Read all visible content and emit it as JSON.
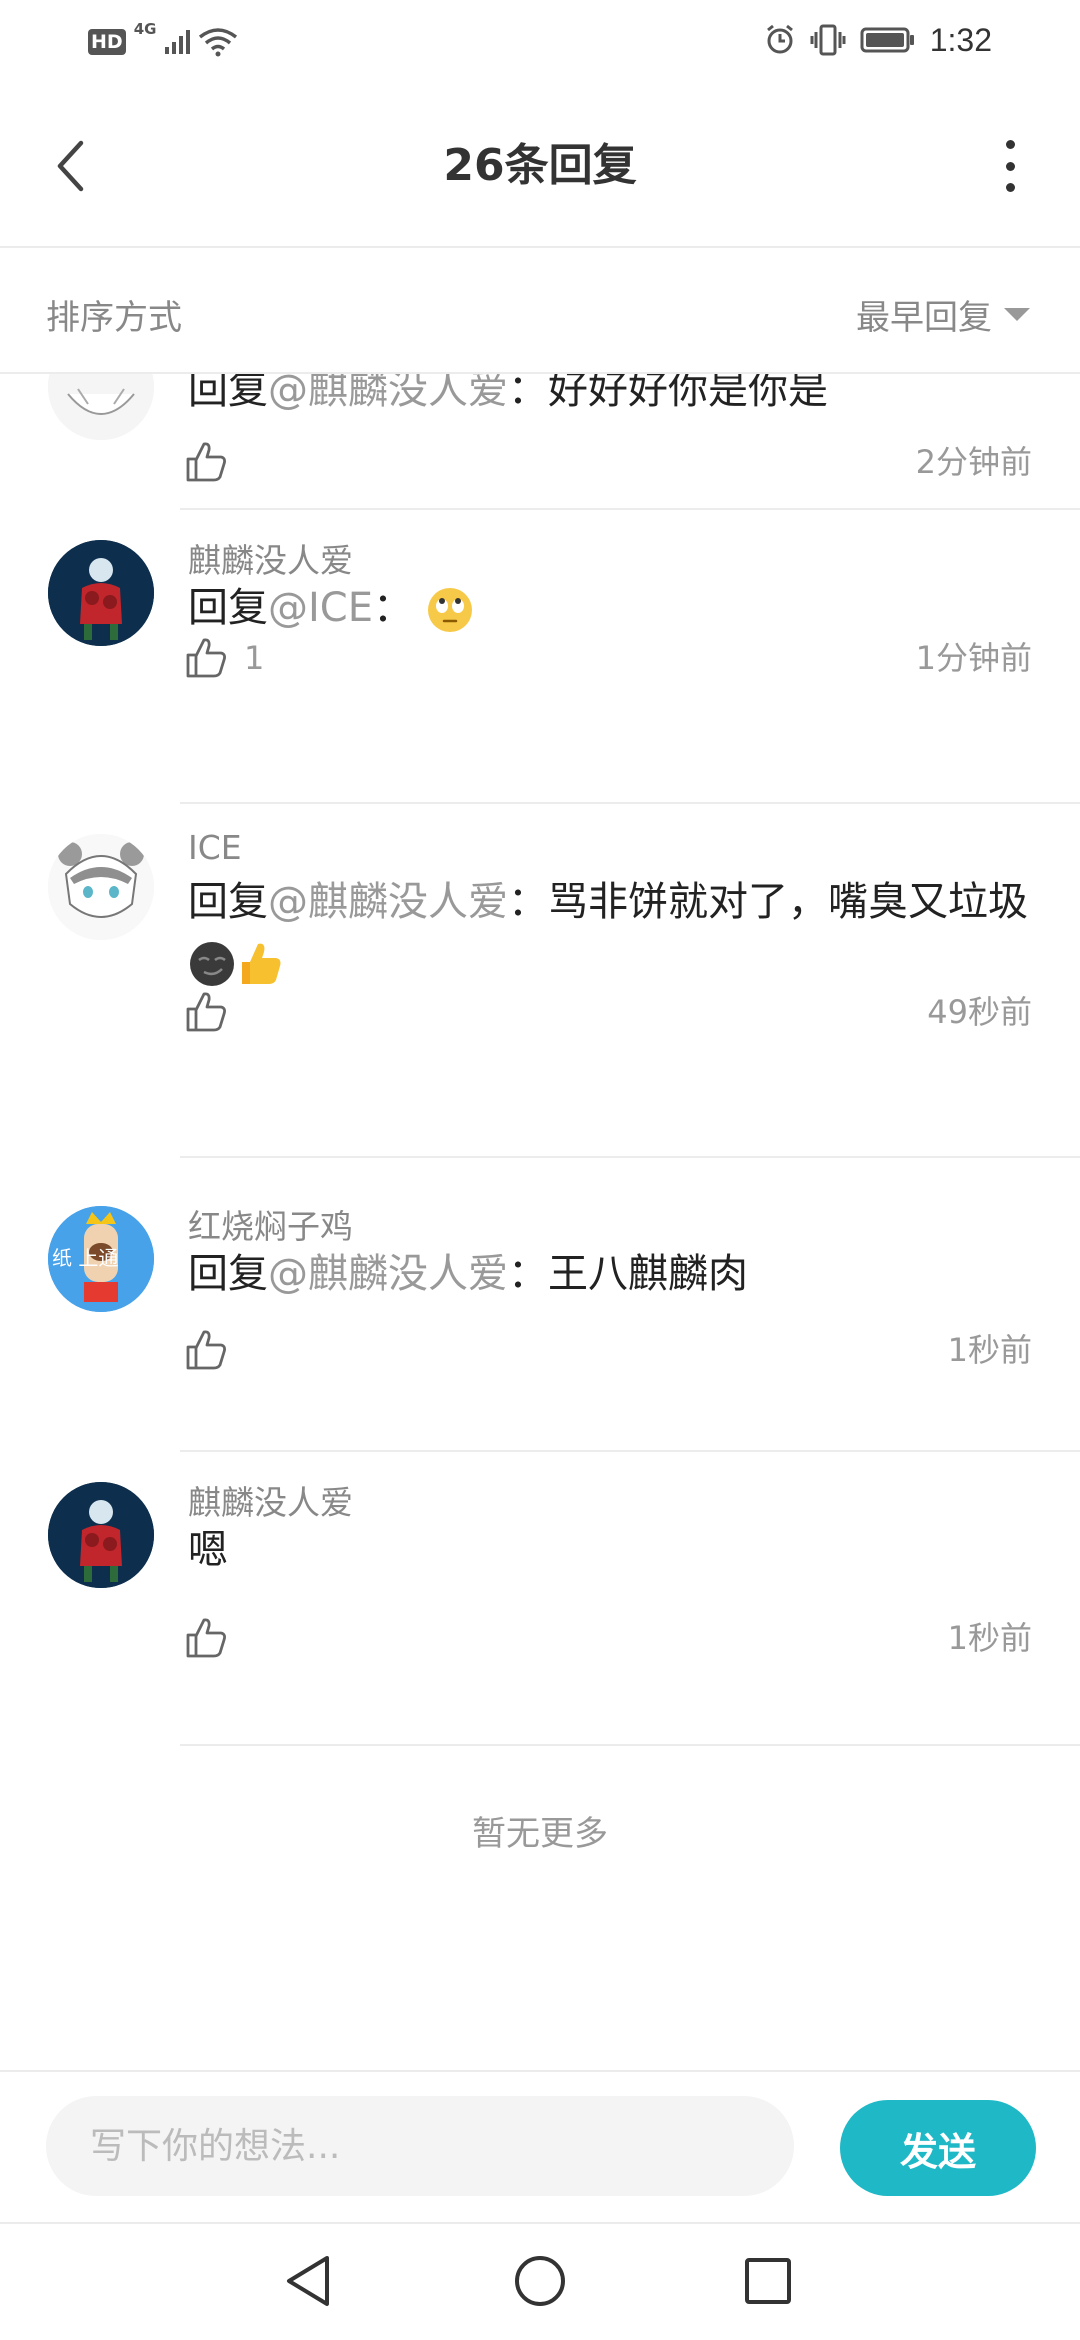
{
  "status_bar": {
    "hd_badge": "HD",
    "network": "4G",
    "time": "1:32"
  },
  "header": {
    "title": "26条回复"
  },
  "sort": {
    "label": "排序方式",
    "value": "最早回复"
  },
  "comments": [
    {
      "username": "",
      "reply_prefix": "回复",
      "mention": "@麒麟没人爱",
      "separator": "：",
      "text": "好好好你是你是",
      "likes": "",
      "time": "2分钟前",
      "avatar": "white-cat-avatar"
    },
    {
      "username": "麒麟没人爱",
      "reply_prefix": "回复",
      "mention": "@ICE",
      "separator": "：",
      "text": "",
      "emoji": "rolling-eyes-emoji",
      "likes": "1",
      "time": "1分钟前",
      "avatar": "game-character-avatar"
    },
    {
      "username": "ICE",
      "reply_prefix": "回复",
      "mention": "@麒麟没人爱",
      "separator": "：",
      "text": "骂非饼就对了，嘴臭又垃圾",
      "emoji": "smirk-emoji, thumbs-up-emoji",
      "likes": "",
      "time": "49秒前",
      "avatar": "anime-boy-avatar"
    },
    {
      "username": "红烧焖子鸡",
      "reply_prefix": "回复",
      "mention": "@麒麟没人爱",
      "separator": "：",
      "text": "王八麒麟肉",
      "likes": "",
      "time": "1秒前",
      "avatar": "crown-character-avatar",
      "avatar_text": "纸 上通"
    },
    {
      "username": "麒麟没人爱",
      "text": "嗯",
      "likes": "",
      "time": "1秒前",
      "avatar": "game-character-avatar"
    }
  ],
  "no_more_text": "暂无更多",
  "input": {
    "placeholder": "写下你的想法...",
    "send_label": "发送"
  },
  "colors": {
    "accent": "#1fb8c6",
    "muted_text": "#999999",
    "primary_text": "#222222",
    "divider": "#ececec"
  }
}
